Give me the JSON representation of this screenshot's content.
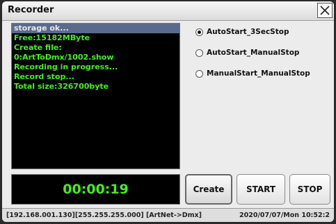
{
  "window": {
    "title": "Recorder"
  },
  "log": {
    "lines": [
      "storage ok...",
      "Free:15182MByte",
      "Create file:",
      "0:ArtToDmx/1002.show",
      "Recording in progress...",
      "Record stop...",
      "Total size:326700byte"
    ]
  },
  "timer": {
    "value": "00:00:19"
  },
  "options": [
    {
      "label": "AutoStart_3SecStop",
      "checked": true
    },
    {
      "label": "AutoStart_ManualStop",
      "checked": false
    },
    {
      "label": "ManualStart_ManualStop",
      "checked": false
    }
  ],
  "buttons": {
    "create": "Create",
    "start": "START",
    "stop": "STOP"
  },
  "status": {
    "network": "[192.168.001.130][255.255.255.000] [ArtNet->Dmx]",
    "datetime": "2020/07/07/Mon 10:52:2"
  },
  "icons": {
    "close": "close-icon"
  }
}
